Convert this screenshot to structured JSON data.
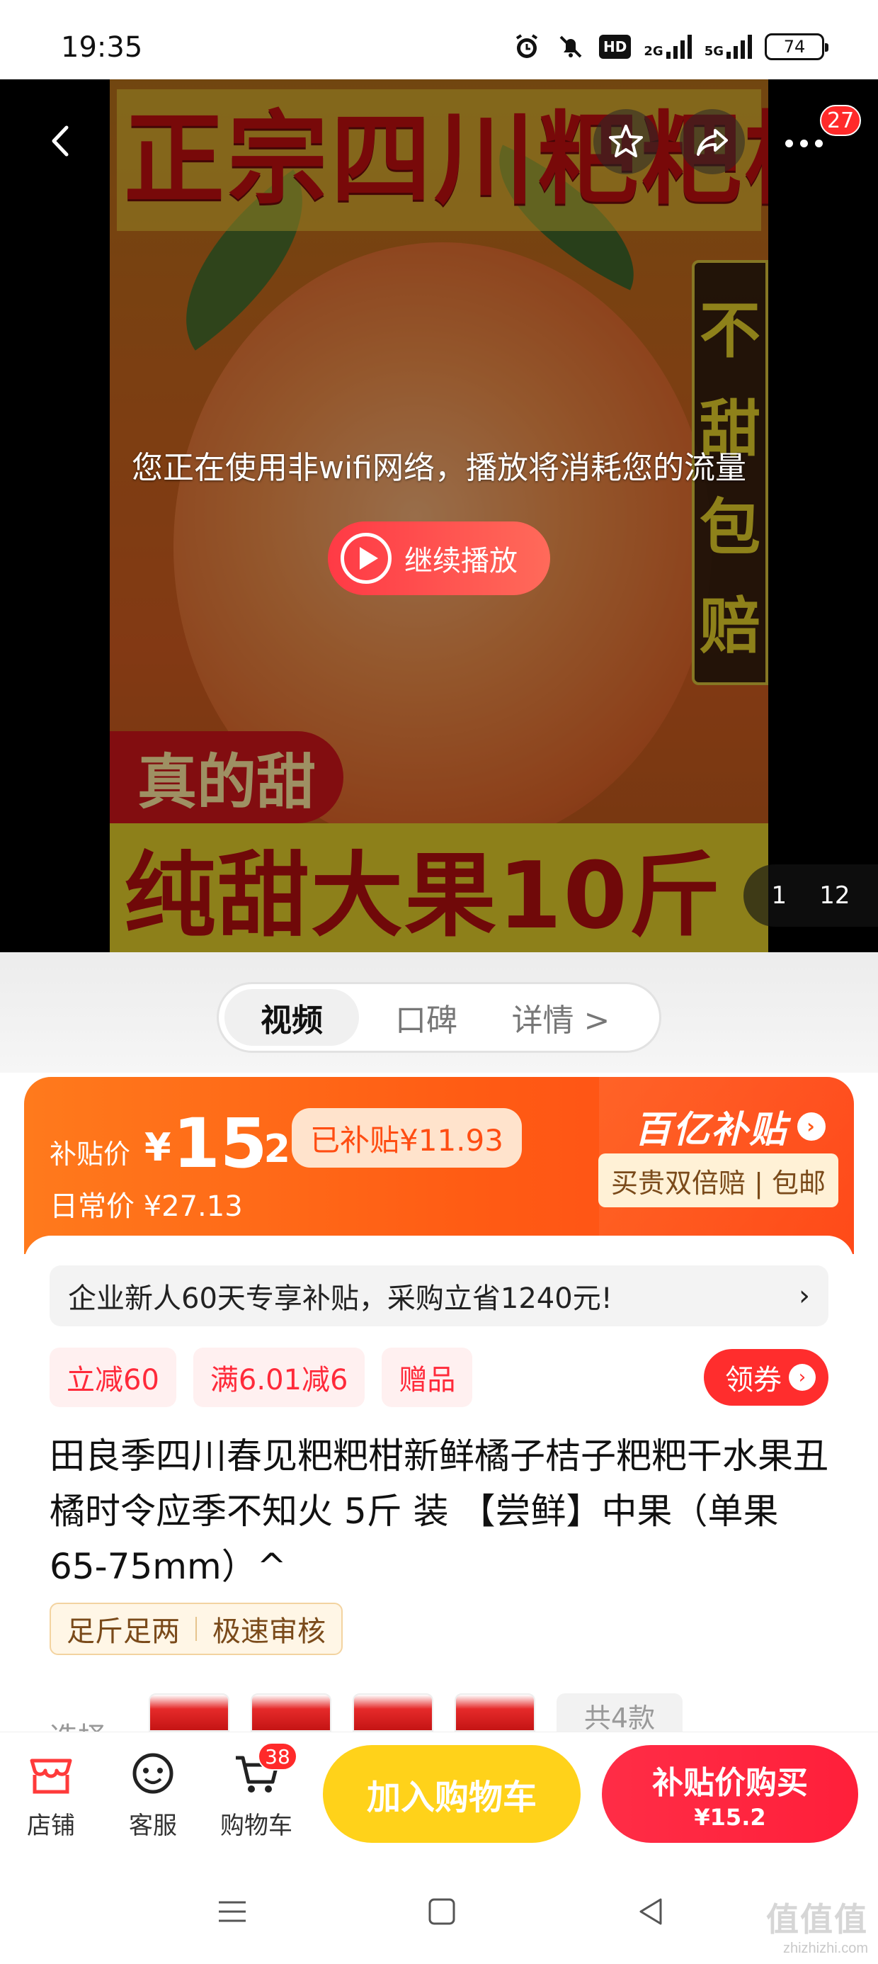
{
  "status_bar": {
    "time": "19:35",
    "icons": [
      "alarm-icon",
      "mute-icon",
      "hd-icon",
      "signal-2g-icon",
      "signal-5g-icon"
    ],
    "hd_text": "HD",
    "sig1_text": "2G",
    "sig2_text": "5G",
    "battery": "74"
  },
  "media": {
    "poster_title": "正宗四川粑粑柑",
    "poster_side_badge": [
      "不",
      "甜",
      "包",
      "赔"
    ],
    "poster_real_sweet": "真的甜",
    "poster_bottom_text": "纯甜大果10斤",
    "wifi_notice": "您正在使用非wifi网络，播放将消耗您的流量",
    "continue_label": "继续播放",
    "pager_current": "1",
    "pager_total": "12",
    "more_badge": "27"
  },
  "tabs": [
    {
      "label": "视频",
      "active": true
    },
    {
      "label": "口碑",
      "active": false
    },
    {
      "label": "详情 >",
      "active": false
    }
  ],
  "price": {
    "label": "补贴价",
    "currency": "¥",
    "integer": "15",
    "decimal": ".2",
    "subsidy_pill": "已补贴¥11.93",
    "daily_label": "日常价 ¥27.13",
    "brand": "百亿补贴",
    "guarantee": "买贵双倍赔 | 包邮",
    "accent_color": "#ff5b14"
  },
  "info": {
    "promo_text": "企业新人60天专享补贴，采购立省1240元!",
    "promo_arrow": "›",
    "chips": [
      "立减60",
      "满6.01减6",
      "赠品"
    ],
    "coupon_label": "领券",
    "title": "田良季四川春见粑粑柑新鲜橘子桔子粑粑干水果丑橘时令应季不知火 5斤 装 【尝鲜】中果（单果65-75mm）^",
    "tags": [
      "足斤足两",
      "极速审核"
    ],
    "variant_label": "选择",
    "variant_all": "共4款"
  },
  "action_bar": {
    "store": "店铺",
    "service": "客服",
    "cart": "购物车",
    "cart_badge": "38",
    "add_to_cart": "加入购物车",
    "buy_title": "补贴价购买",
    "buy_price": "¥15.2"
  },
  "watermark": {
    "big": "值值值",
    "small": "zhizhizhi.com"
  }
}
